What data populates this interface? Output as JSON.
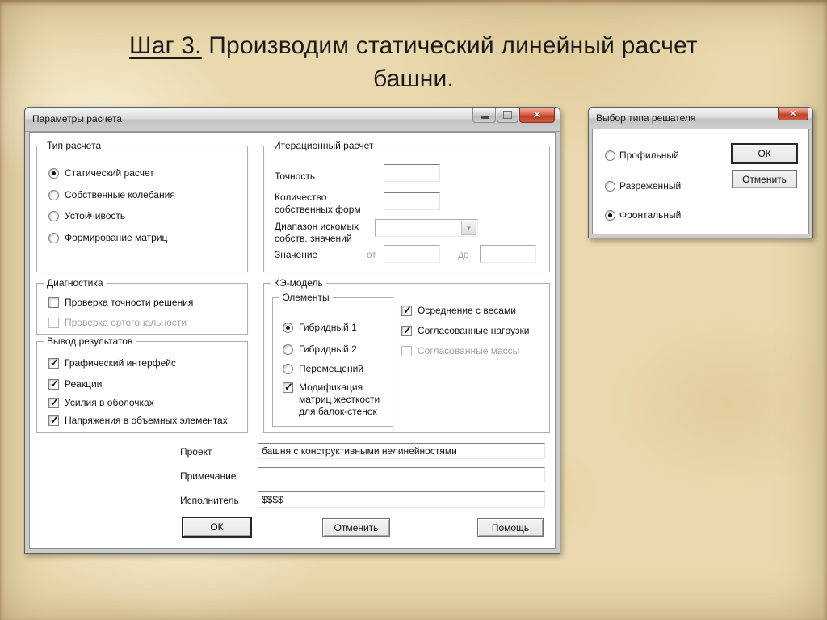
{
  "slide": {
    "title_step": "Шаг 3.",
    "title_line1_rest": " Производим статический линейный расчет",
    "title_line2": "башни."
  },
  "colors": {
    "close_button_red": "#bf3f26",
    "titlebar_grey": "#cecece",
    "parchment": "#ead9ae"
  },
  "params_dialog": {
    "title": "Параметры расчета",
    "window_icons": {
      "minimize": "minimize-icon",
      "maximize": "maximize-icon",
      "close": "close-icon"
    },
    "calc_type": {
      "legend": "Тип расчета",
      "options": [
        {
          "label": "Статический расчет",
          "selected": true
        },
        {
          "label": "Собственные колебания",
          "selected": false
        },
        {
          "label": "Устойчивость",
          "selected": false
        },
        {
          "label": "Формирование матриц",
          "selected": false
        }
      ]
    },
    "iterative": {
      "legend": "Итерационный расчет",
      "accuracy_label": "Точность",
      "forms_label": "Количество собственных форм",
      "range_label": "Диапазон искомых собств. значений",
      "value_label": "Значение",
      "from_label": "от",
      "to_label": "до"
    },
    "diagnostics": {
      "legend": "Диагностика",
      "options": [
        {
          "label": "Проверка точности решения",
          "checked": false,
          "disabled": false
        },
        {
          "label": "Проверка ортогональности",
          "checked": false,
          "disabled": true
        }
      ]
    },
    "output": {
      "legend": "Вывод результатов",
      "options": [
        {
          "label": "Графический интерфейс",
          "checked": true
        },
        {
          "label": "Реакции",
          "checked": true
        },
        {
          "label": "Усилия в оболочках",
          "checked": true
        },
        {
          "label": "Напряжения в объемных элементах",
          "checked": true
        }
      ]
    },
    "fe_model": {
      "legend": "КЭ-модель",
      "elements_legend": "Элементы",
      "element_options": [
        {
          "label": "Гибридный 1",
          "selected": true
        },
        {
          "label": "Гибридный 2",
          "selected": false
        },
        {
          "label": "Перемещений",
          "selected": false
        }
      ],
      "modification": {
        "label": "Модификация матриц жесткости для балок-стенок",
        "checked": true
      },
      "flags": [
        {
          "label": "Осреднение с весами",
          "checked": true,
          "disabled": false
        },
        {
          "label": "Согласованные нагрузки",
          "checked": true,
          "disabled": false
        },
        {
          "label": "Согласованные массы",
          "checked": false,
          "disabled": true
        }
      ]
    },
    "footer_fields": {
      "project_label": "Проект",
      "project_value": "башня с конструктивными нелинейностями",
      "note_label": "Примечание",
      "note_value": "",
      "executor_label": "Исполнитель",
      "executor_value": "$$$$"
    },
    "buttons": {
      "ok": "ОК",
      "cancel": "Отменить",
      "help": "Помощь"
    }
  },
  "solver_dialog": {
    "title": "Выбор типа решателя",
    "window_icons": {
      "close": "close-icon"
    },
    "options": [
      {
        "label": "Профильный",
        "selected": false
      },
      {
        "label": "Разреженный",
        "selected": false
      },
      {
        "label": "Фронтальный",
        "selected": true
      }
    ],
    "buttons": {
      "ok": "ОК",
      "cancel": "Отменить"
    }
  }
}
